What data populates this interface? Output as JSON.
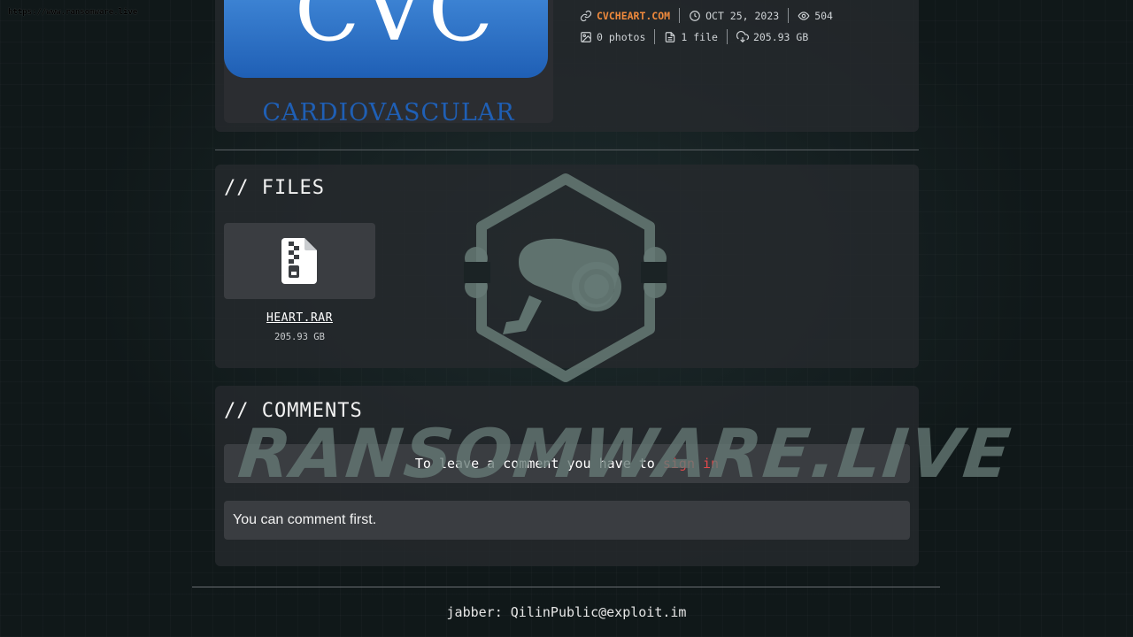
{
  "site_url": "https://www.ransomware.live",
  "logo": {
    "letters": "CVC",
    "caption": "CARDIOVASCULAR"
  },
  "meta": {
    "website": "CVCHEART.COM",
    "date": "OCT 25, 2023",
    "views": "504",
    "photos": "0 photos",
    "files": "1 file",
    "size": "205.93 GB"
  },
  "files_section": {
    "title": "// FILES",
    "items": [
      {
        "name": "HEART.RAR",
        "size": "205.93 GB",
        "icon": "file-archive-icon"
      }
    ]
  },
  "comments_section": {
    "title": "// COMMENTS",
    "signin_prefix": "To leave a comment you have to ",
    "signin_link": "sign in",
    "empty_message": "You can comment first."
  },
  "watermark": {
    "text": "RANSOMWARE.LIVE"
  },
  "footer": {
    "text": "jabber: QilinPublic@exploit.im"
  },
  "colors": {
    "accent_orange": "#f08a3c",
    "link_red": "#e0494b",
    "card_bg": "#26292c"
  }
}
